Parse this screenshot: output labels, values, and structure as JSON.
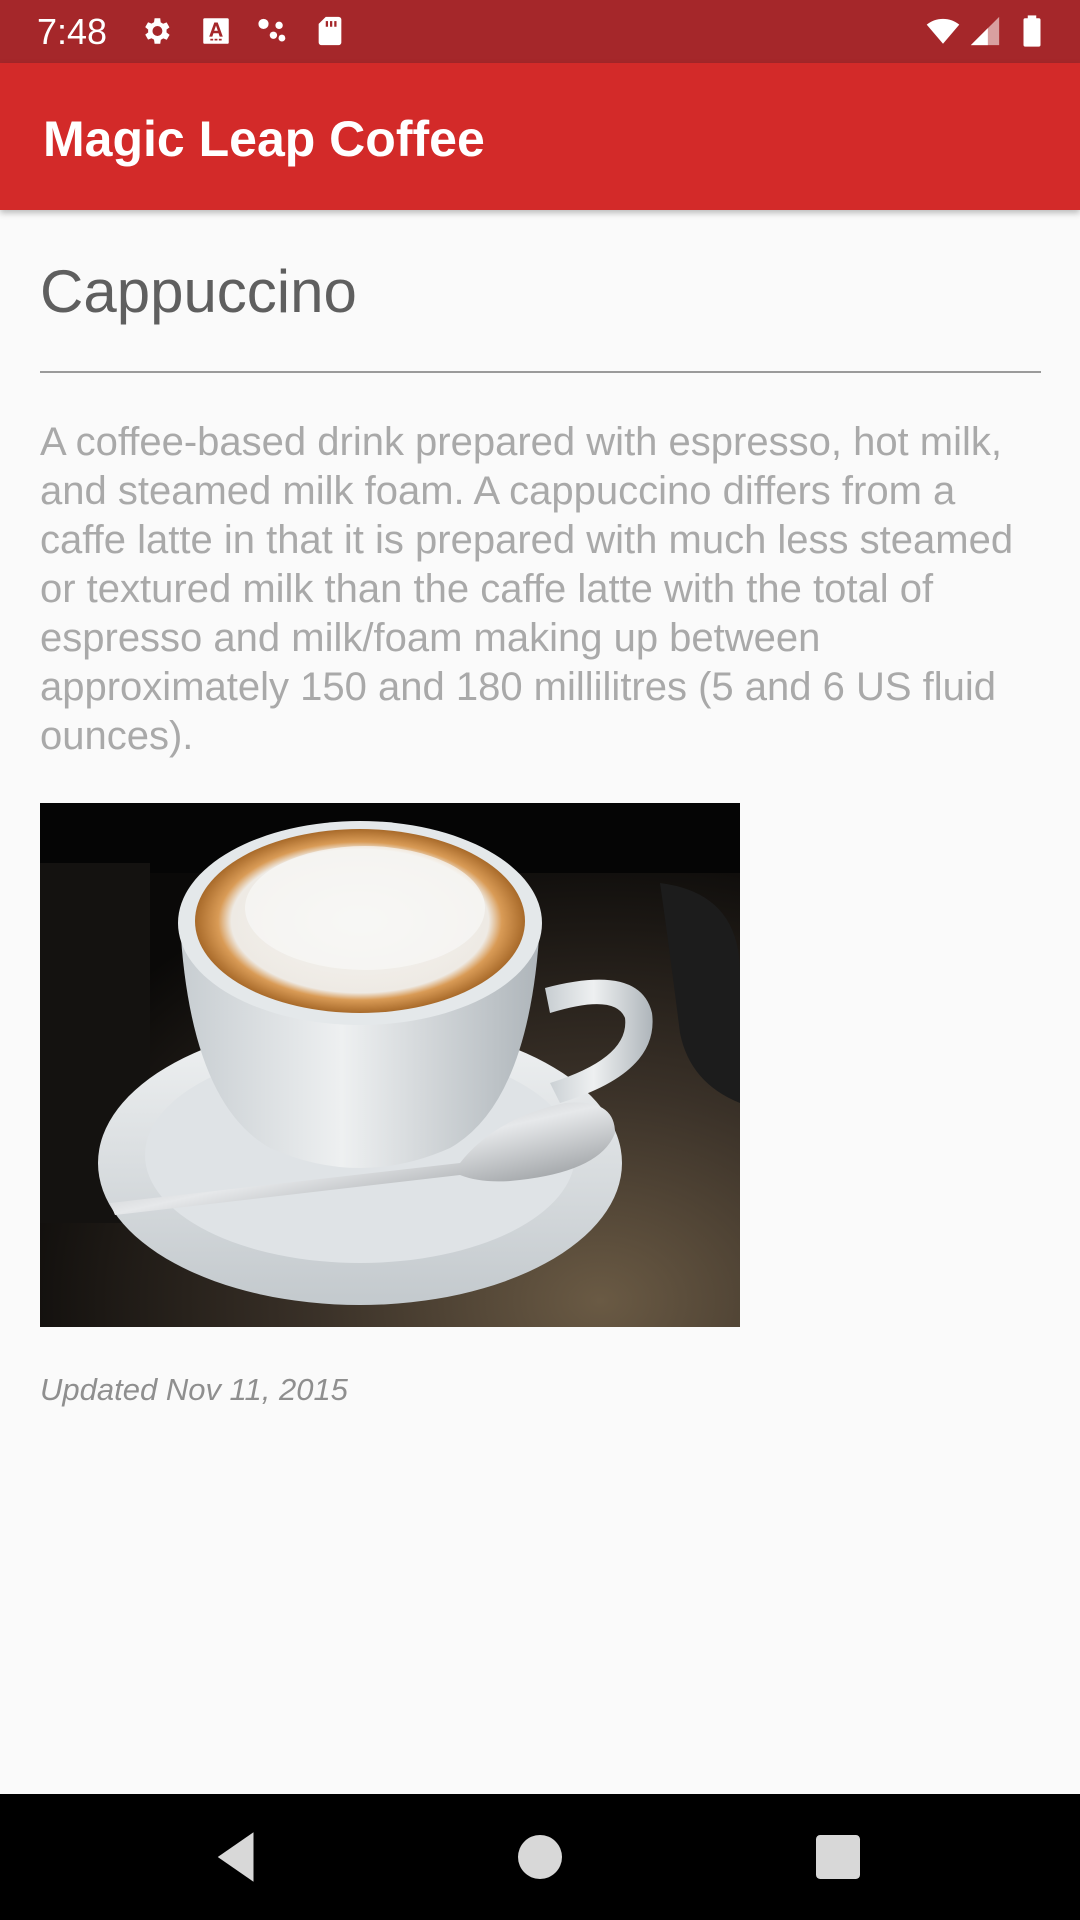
{
  "status_bar": {
    "time": "7:48",
    "left_icons": [
      "gear-icon",
      "font-a-icon",
      "dots-icon",
      "sd-card-icon"
    ],
    "right_icons": [
      "wifi-icon",
      "cell-signal-icon",
      "battery-icon"
    ],
    "background_color": "#a5272a"
  },
  "app_bar": {
    "title": "Magic Leap Coffee",
    "background_color": "#d32a29"
  },
  "drink": {
    "name": "Cappuccino",
    "description": "A coffee-based drink prepared with espresso, hot milk, and steamed milk foam. A cappuccino differs from a caffe latte in that it is prepared with much less steamed or textured milk than the caffe latte with the total of espresso and milk/foam making up between approximately 150 and 180 millilitres (5 and 6 US fluid ounces).",
    "image_subject": "cappuccino-cup-photo",
    "updated": "Updated Nov 11, 2015"
  },
  "nav_bar": {
    "buttons": [
      "back-icon",
      "home-icon",
      "recents-icon"
    ]
  }
}
